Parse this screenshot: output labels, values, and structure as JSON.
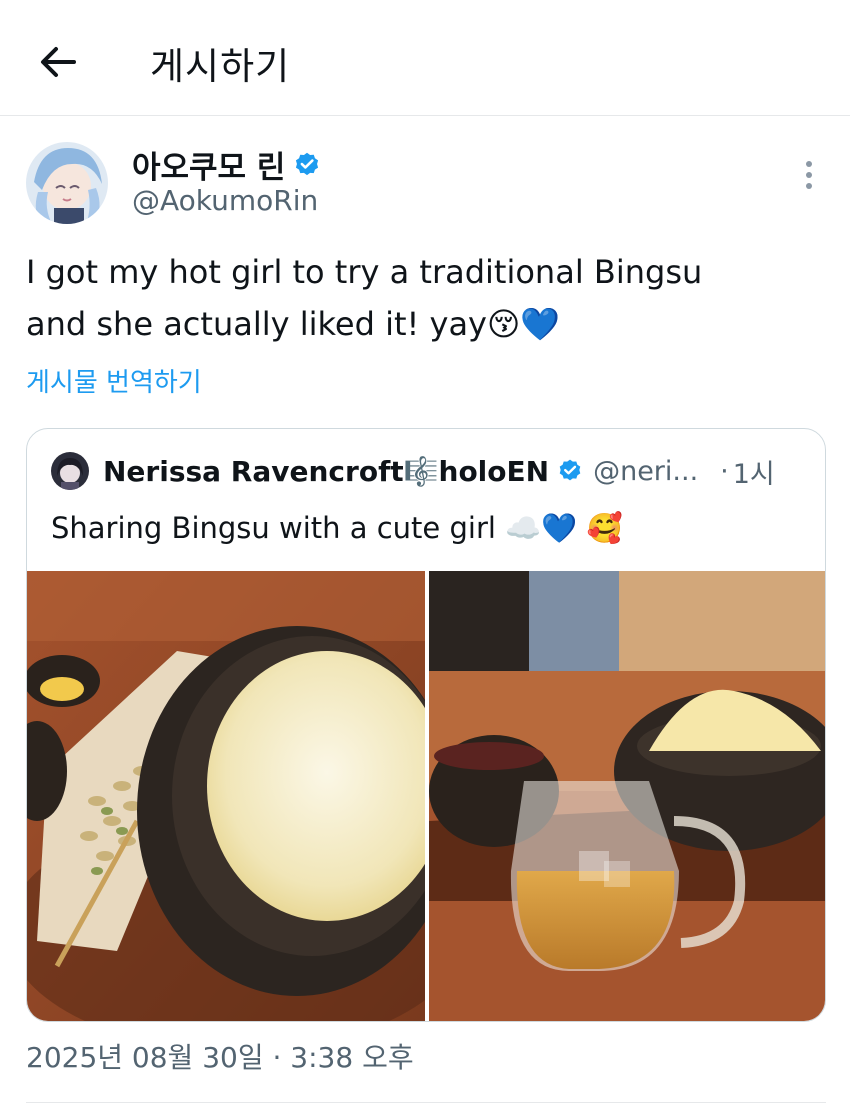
{
  "topbar": {
    "title": "게시하기",
    "back_icon": "arrow-left-icon"
  },
  "tweet": {
    "author": {
      "display_name": "아오쿠모 린",
      "handle": "@AokumoRin",
      "verified": true
    },
    "text_line1": "I got my hot girl to try a traditional Bingsu",
    "text_line2": "and she actually liked it! yay",
    "text_emojis": "😚💙",
    "translate_label": "게시물 번역하기",
    "more_icon": "more-vertical-icon",
    "quoted": {
      "display_name": "Nerissa Ravencroft🎼holoEN",
      "handle": "@neri...",
      "separator": "·",
      "time": "1시",
      "verified": true,
      "text": "Sharing Bingsu with a cute girl",
      "text_emojis": "☁️💙 🥰",
      "photos": [
        "bingsu-bowl-photo",
        "bingsu-tea-photo"
      ]
    },
    "timestamp": "2025년 08월 30일 · 3:38 오후"
  },
  "colors": {
    "accent": "#1d9bf0",
    "text_primary": "#0f1419",
    "text_secondary": "#536471",
    "border": "#cfd9de"
  }
}
